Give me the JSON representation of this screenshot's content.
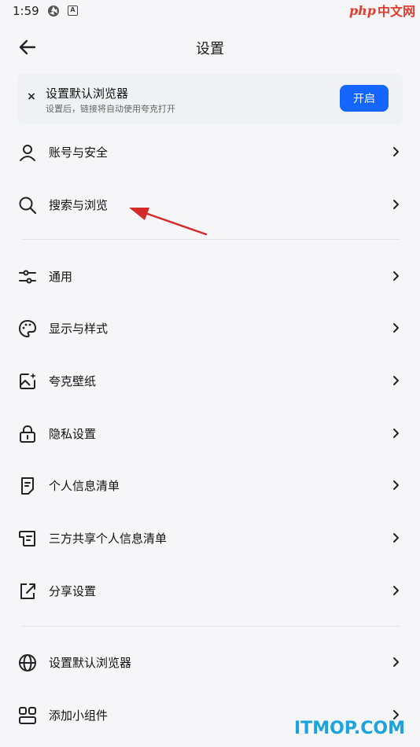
{
  "status_bar": {
    "time": "1:59"
  },
  "watermark_top": {
    "prefix": "php",
    "suffix": "中文网"
  },
  "header": {
    "back_icon": "arrow-left-icon",
    "title": "设置"
  },
  "banner": {
    "title": "设置默认浏览器",
    "subtitle": "设置后，链接将自动使用夸克打开",
    "button_label": "开启",
    "close_label": "×",
    "accent_color": "#1565ff"
  },
  "settings": {
    "items": [
      {
        "label": "账号与安全",
        "icon": "person-icon"
      },
      {
        "label": "搜索与浏览",
        "icon": "search-icon"
      },
      {
        "label": "通用",
        "icon": "sliders-icon"
      },
      {
        "label": "显示与样式",
        "icon": "palette-icon"
      },
      {
        "label": "夸克壁纸",
        "icon": "wallpaper-icon"
      },
      {
        "label": "隐私设置",
        "icon": "lock-icon"
      },
      {
        "label": "个人信息清单",
        "icon": "document-icon"
      },
      {
        "label": "三方共享个人信息清单",
        "icon": "shared-document-icon"
      },
      {
        "label": "分享设置",
        "icon": "share-icon"
      },
      {
        "label": "设置默认浏览器",
        "icon": "globe-icon"
      },
      {
        "label": "添加小组件",
        "icon": "widgets-icon"
      }
    ]
  },
  "watermark_bottom": {
    "text": "ITMOP.COM"
  }
}
